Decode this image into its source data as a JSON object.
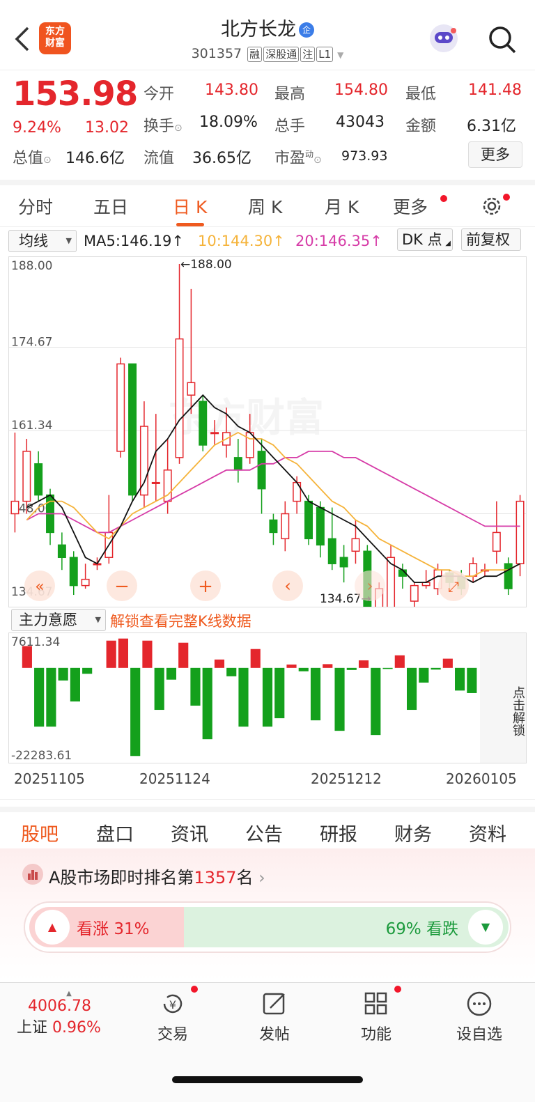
{
  "header": {
    "title": "北方长龙",
    "enterprise_badge": "企",
    "code": "301357",
    "tags": [
      "融",
      "深股通",
      "注",
      "L1"
    ],
    "logo_line1": "东方",
    "logo_line2": "财富"
  },
  "quote": {
    "price": "153.98",
    "change_pct": "9.24%",
    "change_amt": "13.02",
    "open_label": "今开",
    "open": "143.80",
    "high_label": "最高",
    "high": "154.80",
    "low_label": "最低",
    "low": "141.48",
    "turnover_label": "换手",
    "turnover": "18.09%",
    "volume_label": "总手",
    "volume": "43043",
    "amount_label": "金额",
    "amount": "6.31亿",
    "mktcap_label": "总值",
    "mktcap": "146.6亿",
    "float_label": "流值",
    "float": "36.65亿",
    "pe_label": "市盈",
    "pe_sup": "动",
    "pe": "973.93",
    "more": "更多"
  },
  "tabs": [
    "分时",
    "五日",
    "日 K",
    "周 K",
    "月 K",
    "更多"
  ],
  "ma_row": {
    "selector": "均线",
    "ma5": "MA5:146.19",
    "ma10": "10:144.30",
    "ma20": "20:146.35",
    "arrow": "↑",
    "dk": "DK 点",
    "adjust": "前复权"
  },
  "chart_data": [
    {
      "type": "candlestick",
      "title": "",
      "y_ticks": [
        "188.00",
        "174.67",
        "161.34",
        "148.00",
        "134.67"
      ],
      "ylim": [
        134.67,
        188.0
      ],
      "max_label": "←188.00",
      "min_label": "134.67→",
      "watermark": "东方财富",
      "candles": [
        {
          "o": 148,
          "c": 150,
          "h": 161,
          "l": 145
        },
        {
          "o": 150,
          "c": 158,
          "h": 160,
          "l": 148
        },
        {
          "o": 156,
          "c": 151,
          "h": 158,
          "l": 150
        },
        {
          "o": 151,
          "c": 145,
          "h": 152,
          "l": 143
        },
        {
          "o": 143,
          "c": 141,
          "h": 145,
          "l": 139
        },
        {
          "o": 141,
          "c": 136.5,
          "h": 142,
          "l": 135
        },
        {
          "o": 136.5,
          "c": 137.5,
          "h": 140,
          "l": 136
        },
        {
          "o": 140,
          "c": 140,
          "h": 141,
          "l": 139
        },
        {
          "o": 141,
          "c": 145,
          "h": 151,
          "l": 140
        },
        {
          "o": 158,
          "c": 172,
          "h": 173,
          "l": 157
        },
        {
          "o": 172,
          "c": 151,
          "h": 172,
          "l": 150
        },
        {
          "o": 151,
          "c": 162,
          "h": 166,
          "l": 149
        },
        {
          "o": 153,
          "c": 153,
          "h": 164,
          "l": 150
        },
        {
          "o": 150,
          "c": 155,
          "h": 160,
          "l": 148
        },
        {
          "o": 157,
          "c": 176,
          "h": 188,
          "l": 156
        },
        {
          "o": 167,
          "c": 169,
          "h": 184,
          "l": 164
        },
        {
          "o": 166,
          "c": 159,
          "h": 167,
          "l": 158
        },
        {
          "o": 161,
          "c": 161,
          "h": 163,
          "l": 159
        },
        {
          "o": 159,
          "c": 161,
          "h": 165,
          "l": 157
        },
        {
          "o": 157,
          "c": 155,
          "h": 160,
          "l": 153
        },
        {
          "o": 157,
          "c": 161,
          "h": 164,
          "l": 156
        },
        {
          "o": 158,
          "c": 152,
          "h": 160,
          "l": 148
        },
        {
          "o": 147,
          "c": 145,
          "h": 148,
          "l": 143
        },
        {
          "o": 144,
          "c": 148,
          "h": 150,
          "l": 142
        },
        {
          "o": 150,
          "c": 153,
          "h": 154,
          "l": 148
        },
        {
          "o": 150,
          "c": 144,
          "h": 151,
          "l": 143
        },
        {
          "o": 149,
          "c": 143,
          "h": 150,
          "l": 141
        },
        {
          "o": 144,
          "c": 140,
          "h": 149,
          "l": 139
        },
        {
          "o": 141,
          "c": 139.5,
          "h": 143,
          "l": 137
        },
        {
          "o": 142,
          "c": 144,
          "h": 147,
          "l": 140
        },
        {
          "o": 142,
          "c": 131,
          "h": 143,
          "l": 129
        },
        {
          "o": 129,
          "c": 136,
          "h": 137,
          "l": 128
        },
        {
          "o": 133,
          "c": 141,
          "h": 143,
          "l": 132
        },
        {
          "o": 139,
          "c": 138,
          "h": 140,
          "l": 136
        },
        {
          "o": 134,
          "c": 136.5,
          "h": 137,
          "l": 133
        },
        {
          "o": 136.5,
          "c": 137,
          "h": 139,
          "l": 136
        },
        {
          "o": 136,
          "c": 139,
          "h": 140,
          "l": 135
        },
        {
          "o": 138.5,
          "c": 137,
          "h": 139,
          "l": 136
        },
        {
          "o": 138,
          "c": 136,
          "h": 139,
          "l": 135
        },
        {
          "o": 138,
          "c": 140,
          "h": 141,
          "l": 137
        },
        {
          "o": 139,
          "c": 139,
          "h": 140,
          "l": 138
        },
        {
          "o": 142,
          "c": 145,
          "h": 150,
          "l": 140
        },
        {
          "o": 140,
          "c": 136,
          "h": 141,
          "l": 135
        },
        {
          "o": 140,
          "c": 150,
          "h": 151,
          "l": 138
        }
      ],
      "ma5": [
        149,
        150,
        151,
        149,
        145,
        141,
        140,
        143,
        146,
        150,
        153,
        158,
        160,
        163,
        165,
        167,
        165,
        164,
        162,
        161,
        159,
        157,
        155,
        153,
        150,
        149,
        148,
        147,
        146,
        144,
        142,
        140,
        139,
        137,
        137,
        138,
        138,
        138,
        137,
        138,
        138,
        139,
        140
      ],
      "ma10": [
        147,
        149,
        150,
        150,
        149,
        147,
        145,
        144,
        146,
        148,
        149,
        150,
        151,
        153,
        155,
        157,
        159,
        160,
        161,
        160,
        160,
        159,
        157,
        156,
        154,
        152,
        150,
        149,
        147,
        146,
        144,
        143,
        142,
        141,
        140,
        139,
        139,
        138,
        138,
        139,
        139,
        139,
        140
      ],
      "ma20": [
        147,
        148,
        148,
        148,
        147,
        146,
        145,
        145,
        146,
        147,
        148,
        149,
        150,
        151,
        152,
        153,
        154,
        155,
        155,
        155,
        156,
        156,
        157,
        157,
        158,
        158,
        158,
        157,
        157,
        156,
        155,
        154,
        153,
        152,
        151,
        150,
        149,
        148,
        147,
        146,
        146,
        146,
        146
      ]
    },
    {
      "type": "bar",
      "title": "主力意愿",
      "y_ticks": [
        "7611.34",
        "-22283.61"
      ],
      "ylim": [
        -22283.61,
        7611.34
      ],
      "values": [
        0,
        5200,
        -14000,
        -14000,
        -3000,
        -8000,
        -1400,
        0,
        6500,
        7000,
        -21000,
        6500,
        -10000,
        -2800,
        6000,
        -9000,
        -17000,
        2000,
        -2000,
        -14000,
        4500,
        -14000,
        -12000,
        800,
        -800,
        -12500,
        900,
        -15000,
        -500,
        1800,
        -16000,
        -100,
        3000,
        -10000,
        -3500,
        -400,
        2200,
        -5400,
        -6000,
        0,
        0,
        0,
        0
      ]
    }
  ],
  "vol_row": {
    "selector": "主力意愿",
    "unlock_msg": "解锁查看完整K线数据",
    "side": "点击解锁"
  },
  "dates": [
    "20251105",
    "20251124",
    "20251212",
    "20260105"
  ],
  "bottom_tabs": [
    "股吧",
    "盘口",
    "资讯",
    "公告",
    "研报",
    "财务",
    "资料"
  ],
  "rank": {
    "prefix": "A股市场即时排名第",
    "number": "1357",
    "suffix": "名",
    "chev": "›"
  },
  "vote": {
    "up_label": "看涨",
    "up_pct": "31%",
    "up_value": 0.31,
    "down_pct": "69%",
    "down_label": "看跌"
  },
  "nav": {
    "index_value": "4006.78",
    "index_name": "上证",
    "index_pct": "0.96%",
    "items": [
      "交易",
      "发帖",
      "功能",
      "设自选"
    ]
  },
  "colors": {
    "up": "#e4262c",
    "down": "#14a01c",
    "accent": "#ef5a1f",
    "ma5": "#111111",
    "ma10": "#f5b33a",
    "ma20": "#d63ba7"
  }
}
